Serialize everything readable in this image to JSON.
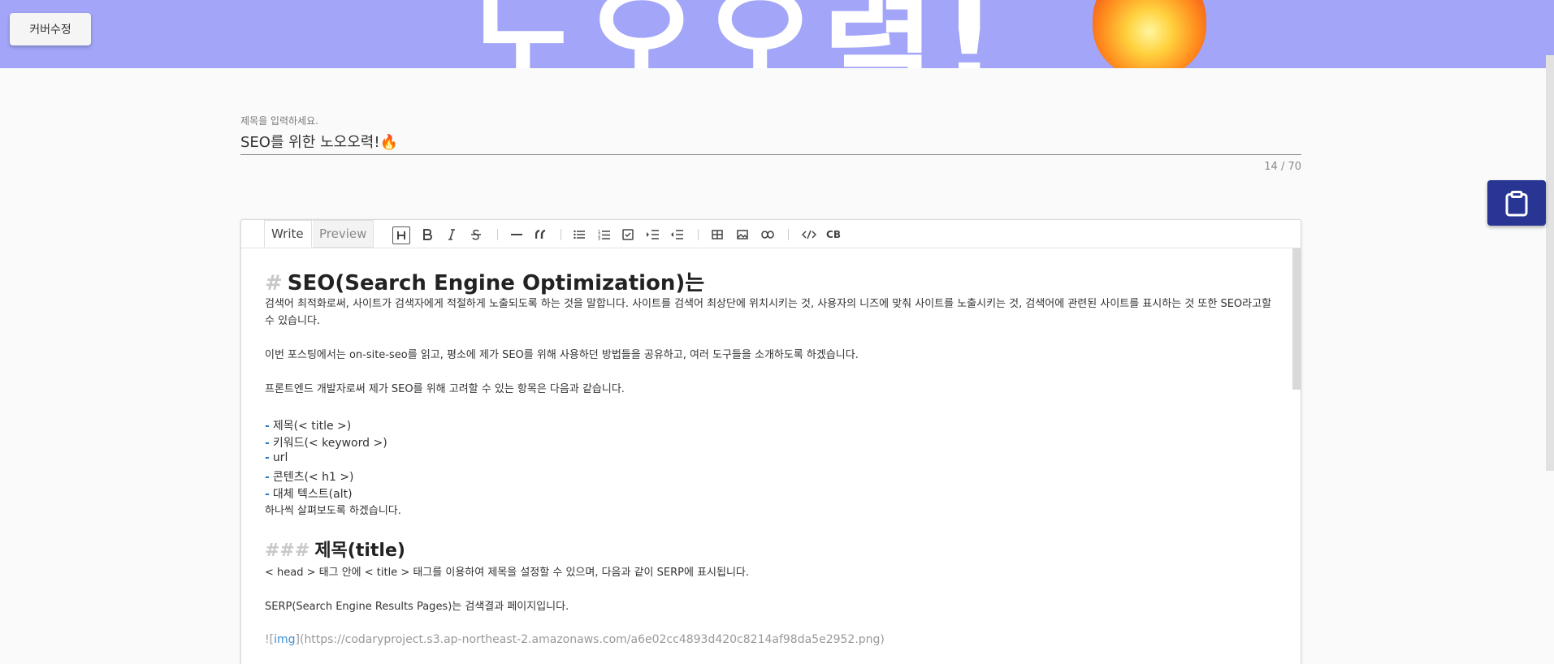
{
  "cover": {
    "text": "노오오력!",
    "button_label": "커버수정"
  },
  "title_field": {
    "label": "제목을 입력하세요.",
    "value": "SEO를 위한 노오오력!🔥",
    "counter": "14 / 70"
  },
  "clipboard": {
    "icon": "clipboard-icon"
  },
  "editor": {
    "tabs": [
      "Write",
      "Preview"
    ],
    "toolbar_icons": [
      "heading-icon",
      "bold-icon",
      "italic-icon",
      "strikethrough-icon",
      "hr-icon",
      "quote-icon",
      "bullet-list-icon",
      "numbered-list-icon",
      "checklist-icon",
      "indent-icon",
      "outdent-icon",
      "table-icon",
      "image-icon",
      "link-icon",
      "code-icon",
      "codeblock-icon"
    ],
    "codeblock_label": "CB",
    "heading1": {
      "hash": "#",
      "text": "SEO(Search Engine Optimization)는"
    },
    "para1": "검색어 최적화로써, 사이트가 검색자에게 적절하게 노출되도록 하는 것을 말합니다. 사이트를 검색어 최상단에 위치시키는 것, 사용자의 니즈에 맞춰 사이트를 노출시키는 것, 검색어에 관련된 사이트를 표시하는 것 또한 SEO라고할 수 있습니다.",
    "para2": "이번 포스팅에서는 on-site-seo를 읽고, 평소에 제가 SEO를 위해 사용하던 방법들을 공유하고, 여러 도구들을 소개하도록 하겠습니다.",
    "para3": "프론트엔드 개발자로써 제가 SEO를 위해 고려할 수 있는 항목은 다음과 같습니다.",
    "list": [
      {
        "dash": "-",
        "text": "제목(< title >)"
      },
      {
        "dash": "-",
        "text": "키워드(< keyword >)"
      },
      {
        "dash": "-",
        "text": "url"
      },
      {
        "dash": "-",
        "text": "콘텐츠(< h1 >)"
      },
      {
        "dash": "-",
        "text": "대체 텍스트(alt)"
      }
    ],
    "para4": "하나씩 살펴보도록 하겠습니다.",
    "heading3": {
      "hash": "###",
      "text": "제목(title)"
    },
    "para5": "< head > 태그 안에 < title > 태그를 이용하여 제목을 설정할 수 있으며, 다음과 같이 SERP에 표시됩니다.",
    "para6": "SERP(Search Engine Results Pages)는 검색결과 페이지입니다.",
    "image_md": {
      "prefix": "![",
      "alt": "img",
      "mid": "](",
      "url": "https://codaryproject.s3.ap-northeast-2.amazonaws.com/a6e02cc4893d420c8214af98da5e2952.png",
      "suffix": ")"
    }
  }
}
